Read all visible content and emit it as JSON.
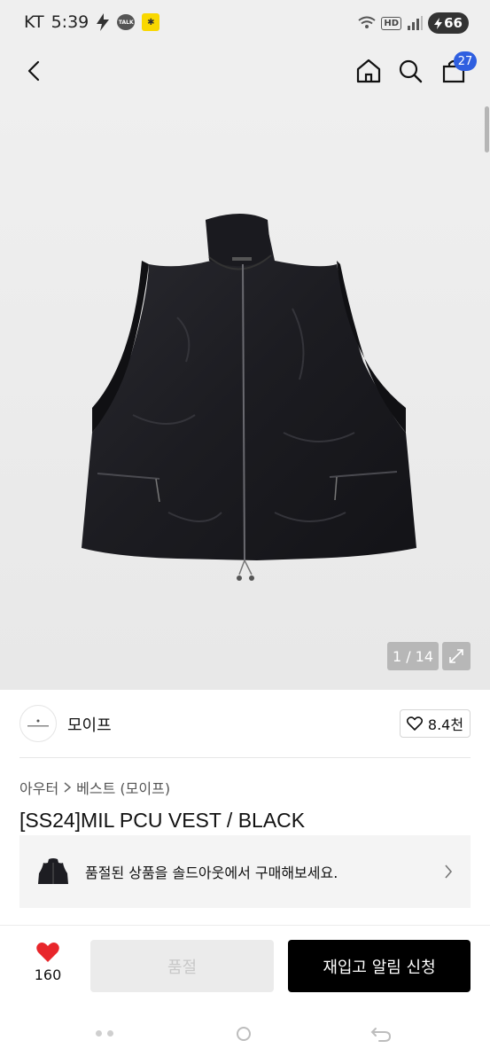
{
  "status_bar": {
    "carrier": "KT",
    "time": "5:39",
    "talk_label": "TALK",
    "hd_label": "HD",
    "battery": "66"
  },
  "header": {
    "cart_count": "27"
  },
  "image": {
    "counter": "1 / 14"
  },
  "seller": {
    "name": "모이프",
    "like_count": "8.4천"
  },
  "breadcrumb": {
    "category": "아우터",
    "subcategory": "베스트 (모이프)"
  },
  "product": {
    "title": "[SS24]MIL PCU VEST / BLACK"
  },
  "banner": {
    "text": "품절된 상품을 솔드아웃에서 구매해보세요."
  },
  "bottom_bar": {
    "like_count": "160",
    "soldout_label": "품절",
    "restock_label": "재입고 알림 신청"
  },
  "colors": {
    "cart_badge": "#2f5fe0",
    "heart": "#e8262b",
    "primary_button": "#000000",
    "disabled_button": "#ebebeb"
  }
}
